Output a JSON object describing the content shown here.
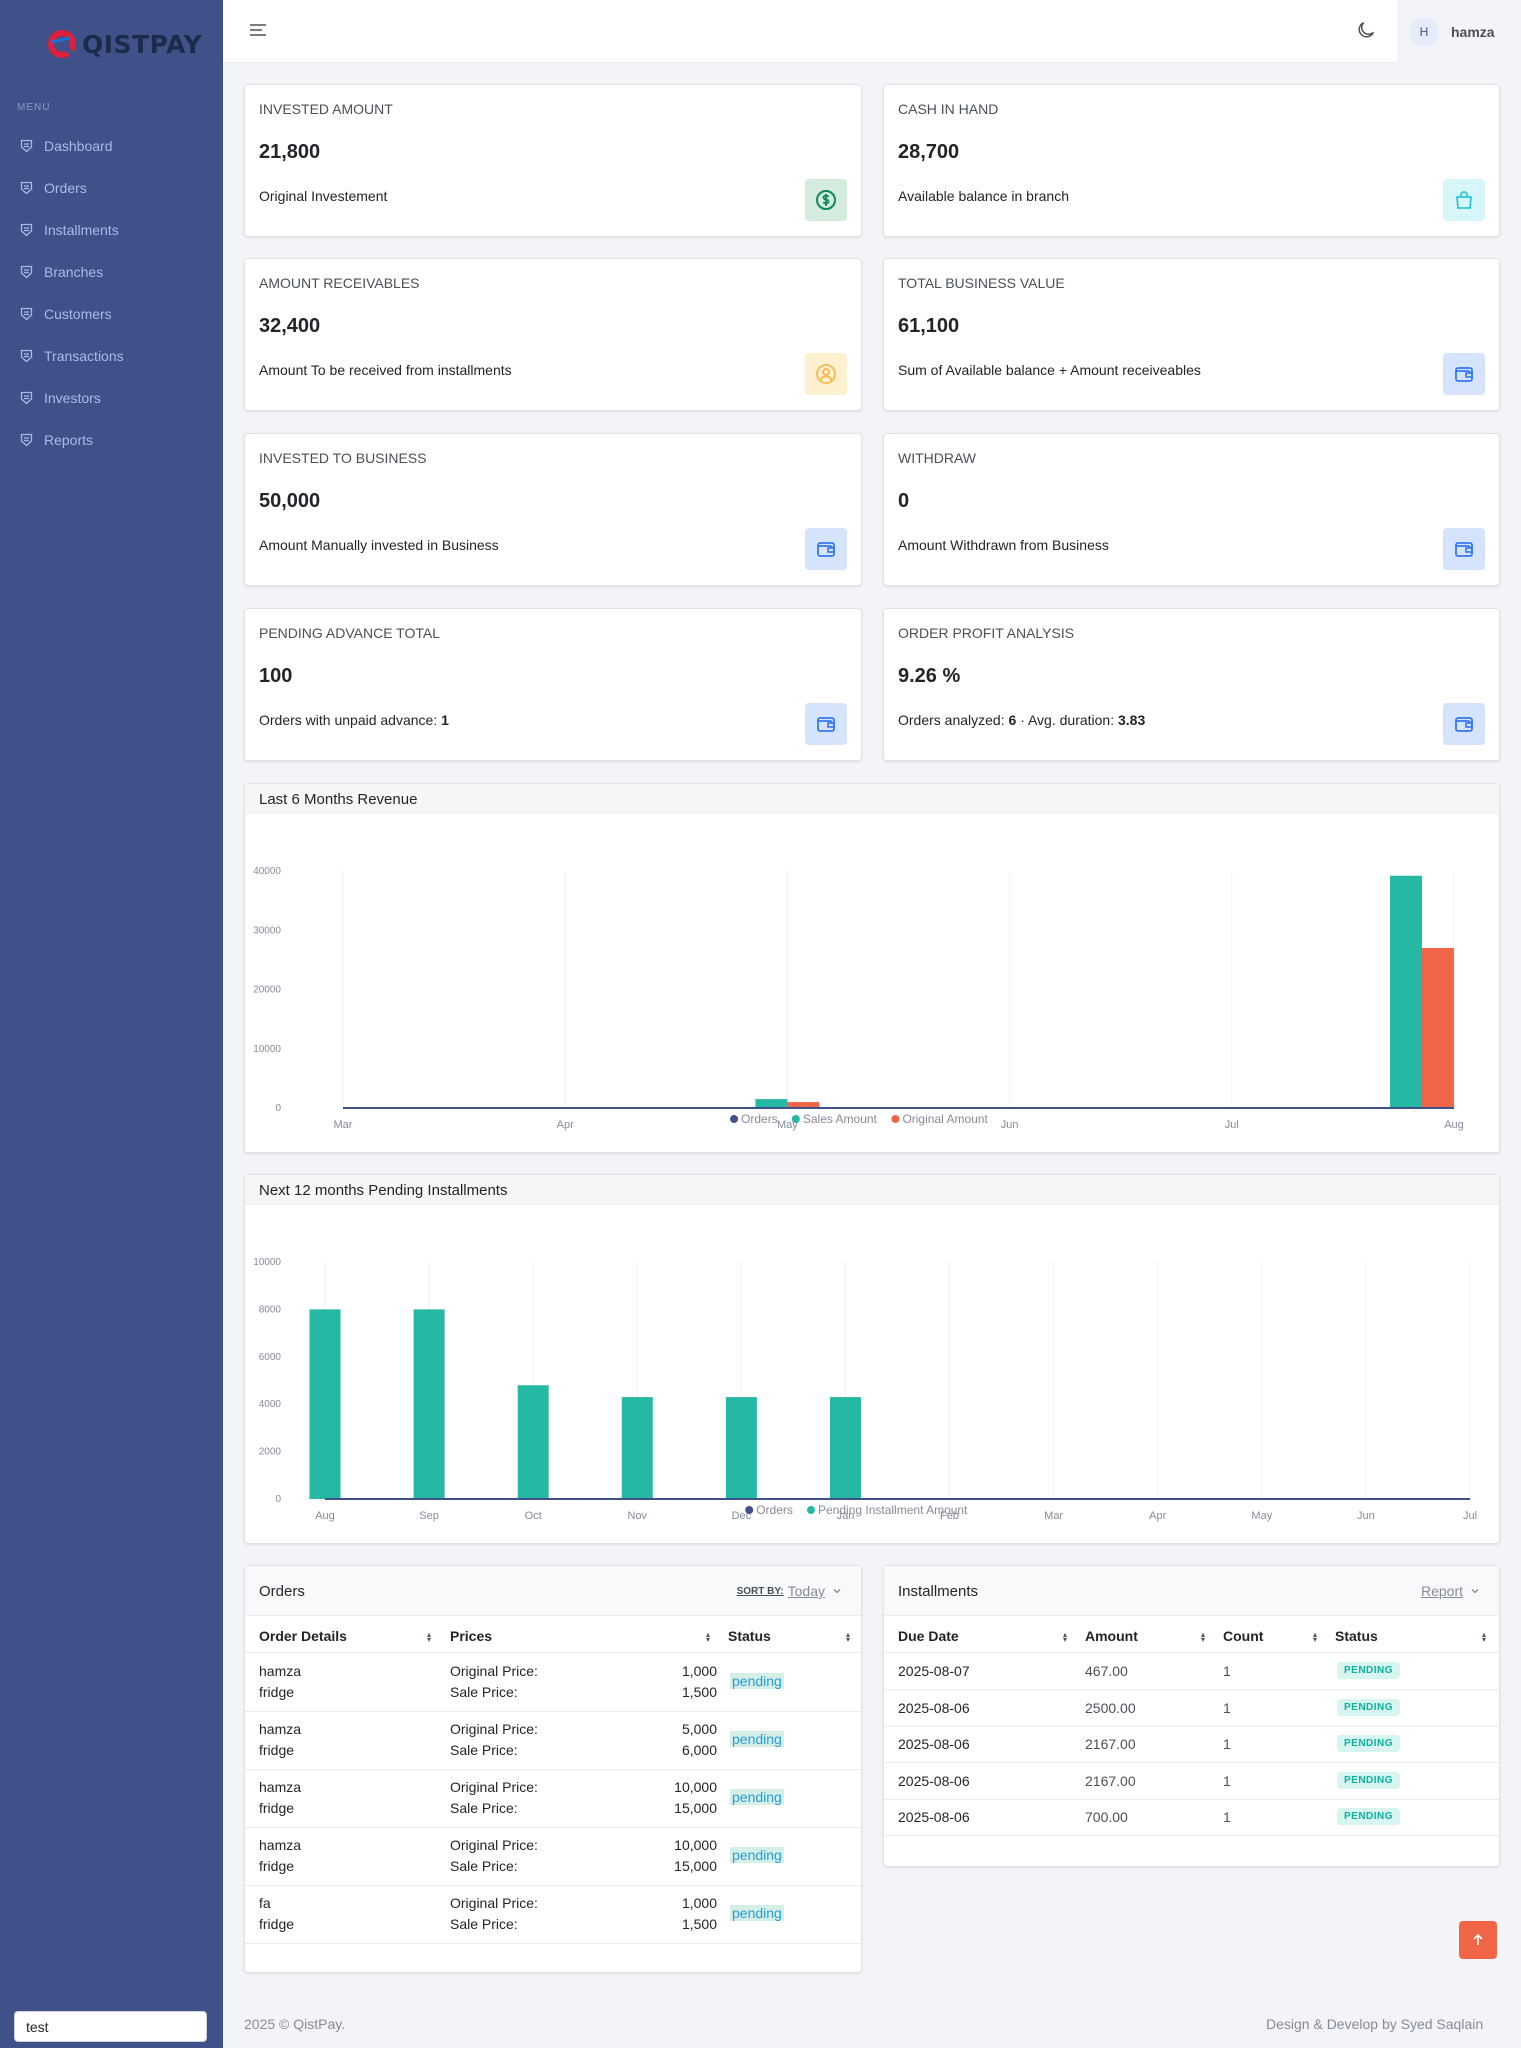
{
  "brand": {
    "name": "QISTPAY"
  },
  "sidebar": {
    "menu_title": "MENU",
    "items": [
      {
        "label": "Dashboard"
      },
      {
        "label": "Orders"
      },
      {
        "label": "Installments"
      },
      {
        "label": "Branches"
      },
      {
        "label": "Customers"
      },
      {
        "label": "Transactions"
      },
      {
        "label": "Investors"
      },
      {
        "label": "Reports"
      }
    ],
    "input_value": "test"
  },
  "header": {
    "user_initial": "H",
    "user_name": "hamza"
  },
  "stats": [
    {
      "title": "INVESTED AMOUNT",
      "value": "21,800",
      "desc": "Original Investement",
      "icon": "dollar-circle-icon"
    },
    {
      "title": "CASH IN HAND",
      "value": "28,700",
      "desc": "Available balance in branch",
      "icon": "shopping-bag-icon"
    },
    {
      "title": "AMOUNT RECEIVABLES",
      "value": "32,400",
      "desc": "Amount To be received from installments",
      "icon": "user-circle-icon"
    },
    {
      "title": "TOTAL BUSINESS VALUE",
      "value": "61,100",
      "desc": "Sum of Available balance + Amount receiveables",
      "icon": "wallet-icon"
    },
    {
      "title": "INVESTED TO BUSINESS",
      "value": "50,000",
      "desc": "Amount Manually invested in Business",
      "icon": "wallet-icon"
    },
    {
      "title": "WITHDRAW",
      "value": "0",
      "desc": "Amount Withdrawn from Business",
      "icon": "wallet-icon"
    },
    {
      "title": "PENDING ADVANCE TOTAL",
      "value": "100",
      "desc": "Orders with unpaid advance:",
      "desc_strong": "1",
      "icon": "wallet-icon"
    },
    {
      "title": "ORDER PROFIT ANALYSIS",
      "value": "9.26 %",
      "desc": "Orders analyzed:",
      "desc_strong": "6",
      "desc2": "· Avg. duration:",
      "desc2_strong": "3.83",
      "icon": "wallet-icon"
    }
  ],
  "colors": {
    "sidebar": "#405189",
    "orders": "#405189",
    "sales": "#25b9a3",
    "original": "#f06548",
    "pending_installment": "#25b9a3"
  },
  "chart_data": [
    {
      "type": "bar",
      "title": "Last 6 Months Revenue",
      "categories": [
        "Mar",
        "Apr",
        "May",
        "Jun",
        "Jul",
        "Aug"
      ],
      "series": [
        {
          "name": "Orders",
          "type": "line",
          "values": [
            0,
            0,
            0,
            0,
            0,
            0
          ]
        },
        {
          "name": "Sales Amount",
          "values": [
            0,
            0,
            1500,
            0,
            0,
            39200
          ]
        },
        {
          "name": "Original Amount",
          "values": [
            0,
            0,
            1000,
            0,
            0,
            27000
          ]
        }
      ],
      "yticks": [
        0,
        10000,
        20000,
        30000,
        40000
      ],
      "ylim": [
        0,
        40000
      ],
      "legend": "bottom"
    },
    {
      "type": "bar",
      "title": "Next 12 months Pending Installments",
      "categories": [
        "Aug",
        "Sep",
        "Oct",
        "Nov",
        "Dec",
        "Jan",
        "Feb",
        "Mar",
        "Apr",
        "May",
        "Jun",
        "Jul"
      ],
      "series": [
        {
          "name": "Orders",
          "type": "line",
          "values": [
            0,
            0,
            0,
            0,
            0,
            0,
            0,
            0,
            0,
            0,
            0,
            0
          ]
        },
        {
          "name": "Pending Installment Amount",
          "values": [
            8000,
            8000,
            4800,
            4300,
            4300,
            4300,
            0,
            0,
            0,
            0,
            0,
            0
          ]
        }
      ],
      "yticks": [
        0,
        2000,
        4000,
        6000,
        8000,
        10000
      ],
      "ylim": [
        0,
        10000
      ],
      "legend": "bottom"
    }
  ],
  "orders_table": {
    "title": "Orders",
    "sort_label": "SORT BY:",
    "sort_value": "Today",
    "columns": [
      "Order Details",
      "Prices",
      "Status"
    ],
    "original_label": "Original Price:",
    "sale_label": "Sale Price:",
    "rows": [
      {
        "customer": "hamza",
        "product": "fridge",
        "original": "1,000",
        "sale": "1,500",
        "status": "pending"
      },
      {
        "customer": "hamza",
        "product": "fridge",
        "original": "5,000",
        "sale": "6,000",
        "status": "pending"
      },
      {
        "customer": "hamza",
        "product": "fridge",
        "original": "10,000",
        "sale": "15,000",
        "status": "pending"
      },
      {
        "customer": "hamza",
        "product": "fridge",
        "original": "10,000",
        "sale": "15,000",
        "status": "pending"
      },
      {
        "customer": "fa",
        "product": "fridge",
        "original": "1,000",
        "sale": "1,500",
        "status": "pending"
      }
    ]
  },
  "installments_table": {
    "title": "Installments",
    "report_label": "Report",
    "columns": [
      "Due Date",
      "Amount",
      "Count",
      "Status"
    ],
    "rows": [
      {
        "due": "2025-08-07",
        "amount": "467.00",
        "count": "1",
        "status": "PENDING"
      },
      {
        "due": "2025-08-06",
        "amount": "2500.00",
        "count": "1",
        "status": "PENDING"
      },
      {
        "due": "2025-08-06",
        "amount": "2167.00",
        "count": "1",
        "status": "PENDING"
      },
      {
        "due": "2025-08-06",
        "amount": "2167.00",
        "count": "1",
        "status": "PENDING"
      },
      {
        "due": "2025-08-06",
        "amount": "700.00",
        "count": "1",
        "status": "PENDING"
      }
    ]
  },
  "footer": {
    "left": "2025 © QistPay.",
    "right": "Design & Develop by Syed Saqlain"
  }
}
